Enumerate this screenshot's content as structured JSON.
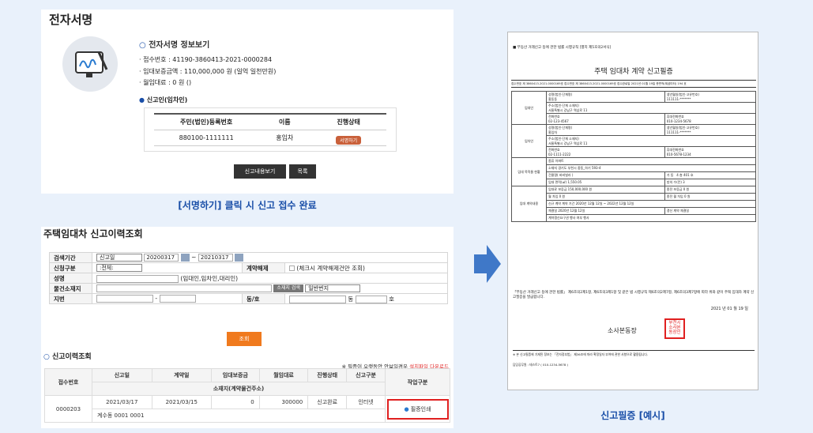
{
  "panel1": {
    "title": "전자서명",
    "info_title": "전자서명 정보보기",
    "receipt_no": "· 접수번호 : 41190-3860413-2021-0000284",
    "deposit": "· 임대보증금액 : 110,000,000 원 (일억 일천만원)",
    "monthly": "· 월임대료 : 0 원 ()",
    "reporter_title": "신고인(임차인)",
    "table_headers": [
      "주민(법인)등록번호",
      "이름",
      "진행상태"
    ],
    "table_row": [
      "880100-1111111",
      "홍임차",
      "서명하기"
    ],
    "btn_view": "신고내용보기",
    "btn_list": "목록"
  },
  "caption1": "[서명하기] 클릭 시 신고 접수 완료",
  "panel2": {
    "title": "주택임대차 신고이력조회",
    "labels": {
      "period": "검색기간",
      "type": "신청구분",
      "name": "성명",
      "address": "물건소재지",
      "lot": "지번",
      "cancel": "계약해제",
      "dong": "동/호"
    },
    "period_select": "신고일",
    "date_from": "20200317",
    "date_to": "20210317",
    "tilde": "~",
    "type_select": ":전체:",
    "cancel_check": "(체크시 계약해제건만 조회)",
    "name_hint": "(임대인,임차인,대리인)",
    "addr_btn": "소재지 검색",
    "addr_select": "일반번지",
    "dash": "-",
    "dong_suffix": "동",
    "ho_suffix": "호",
    "search_btn": "조회",
    "history_title": "신고이력조회",
    "note_prefix": "※ 필증이 오랫동안 안보일경우",
    "note_link": "설치파일 다운로드",
    "headers": [
      "접수번호",
      "신고일",
      "계약일",
      "임대보증금",
      "월임대료",
      "진행상태",
      "신고구분",
      "작업구분"
    ],
    "subheader": "소재지(계약물건주소)",
    "row": {
      "receipt": "0000203",
      "report_date": "2021/03/17",
      "contract_date": "2021/03/15",
      "deposit": "0",
      "rent": "300000",
      "status": "신고완료",
      "type": "인터넷",
      "action": "필증인쇄",
      "sub": "계수동 0001 0001"
    }
  },
  "doc": {
    "law": "■ 부동산 거래신고 등에 관한 법률 시행규칙 [별지 제5호의2서식]",
    "title": "주택 임대차 계약 신고필증",
    "meta": "접수번호 제 3860413-2021-0000169호   접수번호 제 3860413-2021-0000169호   접수완료일 2021년 01월 19일   총면적(제곱미터) 194 호",
    "landlord": "임대인",
    "tenant": "임차인",
    "ll_name_lbl": "성명(법인·단체명)",
    "ll_name": "홍동동",
    "ll_id_lbl": "생년월일(법인·고유번호)",
    "ll_id": "111111-*******",
    "ll_addr_lbl": "주소(법인·단체 소재지)",
    "ll_addr": "서울특별시 강남구 역삼로 11",
    "ll_tel_lbl": "전화번호",
    "ll_tel": "02-123-4567",
    "ll_mob_lbl": "휴대전화번호",
    "ll_mob": "010-1234-5678",
    "tn_name": "홍임차",
    "tn_id": "111111-*******",
    "tn_addr": "서울특별시 강남구 역삼로 11",
    "tn_tel": "02-1111-2222",
    "tn_mob": "010-5678-1234",
    "obj_lbl": "임대 목적물 현황",
    "obj_type_lbl": "종류",
    "obj_type": "아파트",
    "obj_addr_lbl": "소재지",
    "obj_addr": "경기도 부천시 중동_하기 593-4",
    "obj_bldg": "건물명( 바비빌라 )",
    "obj_dong": "가 동",
    "obj_ho": "4 층 401 호",
    "obj_area_lbl": "임대 면적(㎡)",
    "obj_area": "1,550.05",
    "obj_rooms_lbl": "방의 수(칸)",
    "obj_rooms": "3",
    "contract_lbl": "임대 계약내용",
    "new_lbl": "신규 계약",
    "fee_lbl": "임대료",
    "deposit_lbl": "보증금",
    "deposit": "150,000,000 원",
    "prev_dep_lbl": "종전 보증금",
    "prev_dep": "0 원",
    "rent_lbl": "월 차임",
    "rent": "0 원",
    "prev_rent_lbl": "종전 월 차임",
    "prev_rent": "0 원",
    "period_lbl": "계약 기간",
    "period": "2020년 12월 12일 ~ 2022년 12월 12일",
    "sign_lbl": "체결일",
    "sign": "2020년 12월 12일",
    "renew_lbl": "갱신 계약 체결일",
    "renew_req": "계약갱신요구권 행사 여부 행사",
    "statement": "「부동산 거래신고 등에 관한 법률」 제6조의2제1항, 제6조의3제1항 및 같은 법 시행규칙 제6조의2제7항, 제6조의3제7항에 따라 위와 같이 주택 임대차 계약 신고필증을 발급합니다.",
    "date": "2021 년 01 월 19 일",
    "issuer": "소사본동장",
    "seal": "부천시소사본동장인",
    "footer": "※ 본 신고필증에 기재된 정보는 「전자정부법」 제36조에 따라 확정일자 부여에 관한 사항으로 활용됩니다.",
    "contact": "담당공무원 : 테스트7 ( 010-1234-5678 )"
  },
  "caption2": "신고필증 [예시]",
  "colors": {
    "orange": "#f07a1e",
    "blue": "#1a4fa8",
    "red": "#e02020",
    "arrow": "#3f78c8"
  }
}
